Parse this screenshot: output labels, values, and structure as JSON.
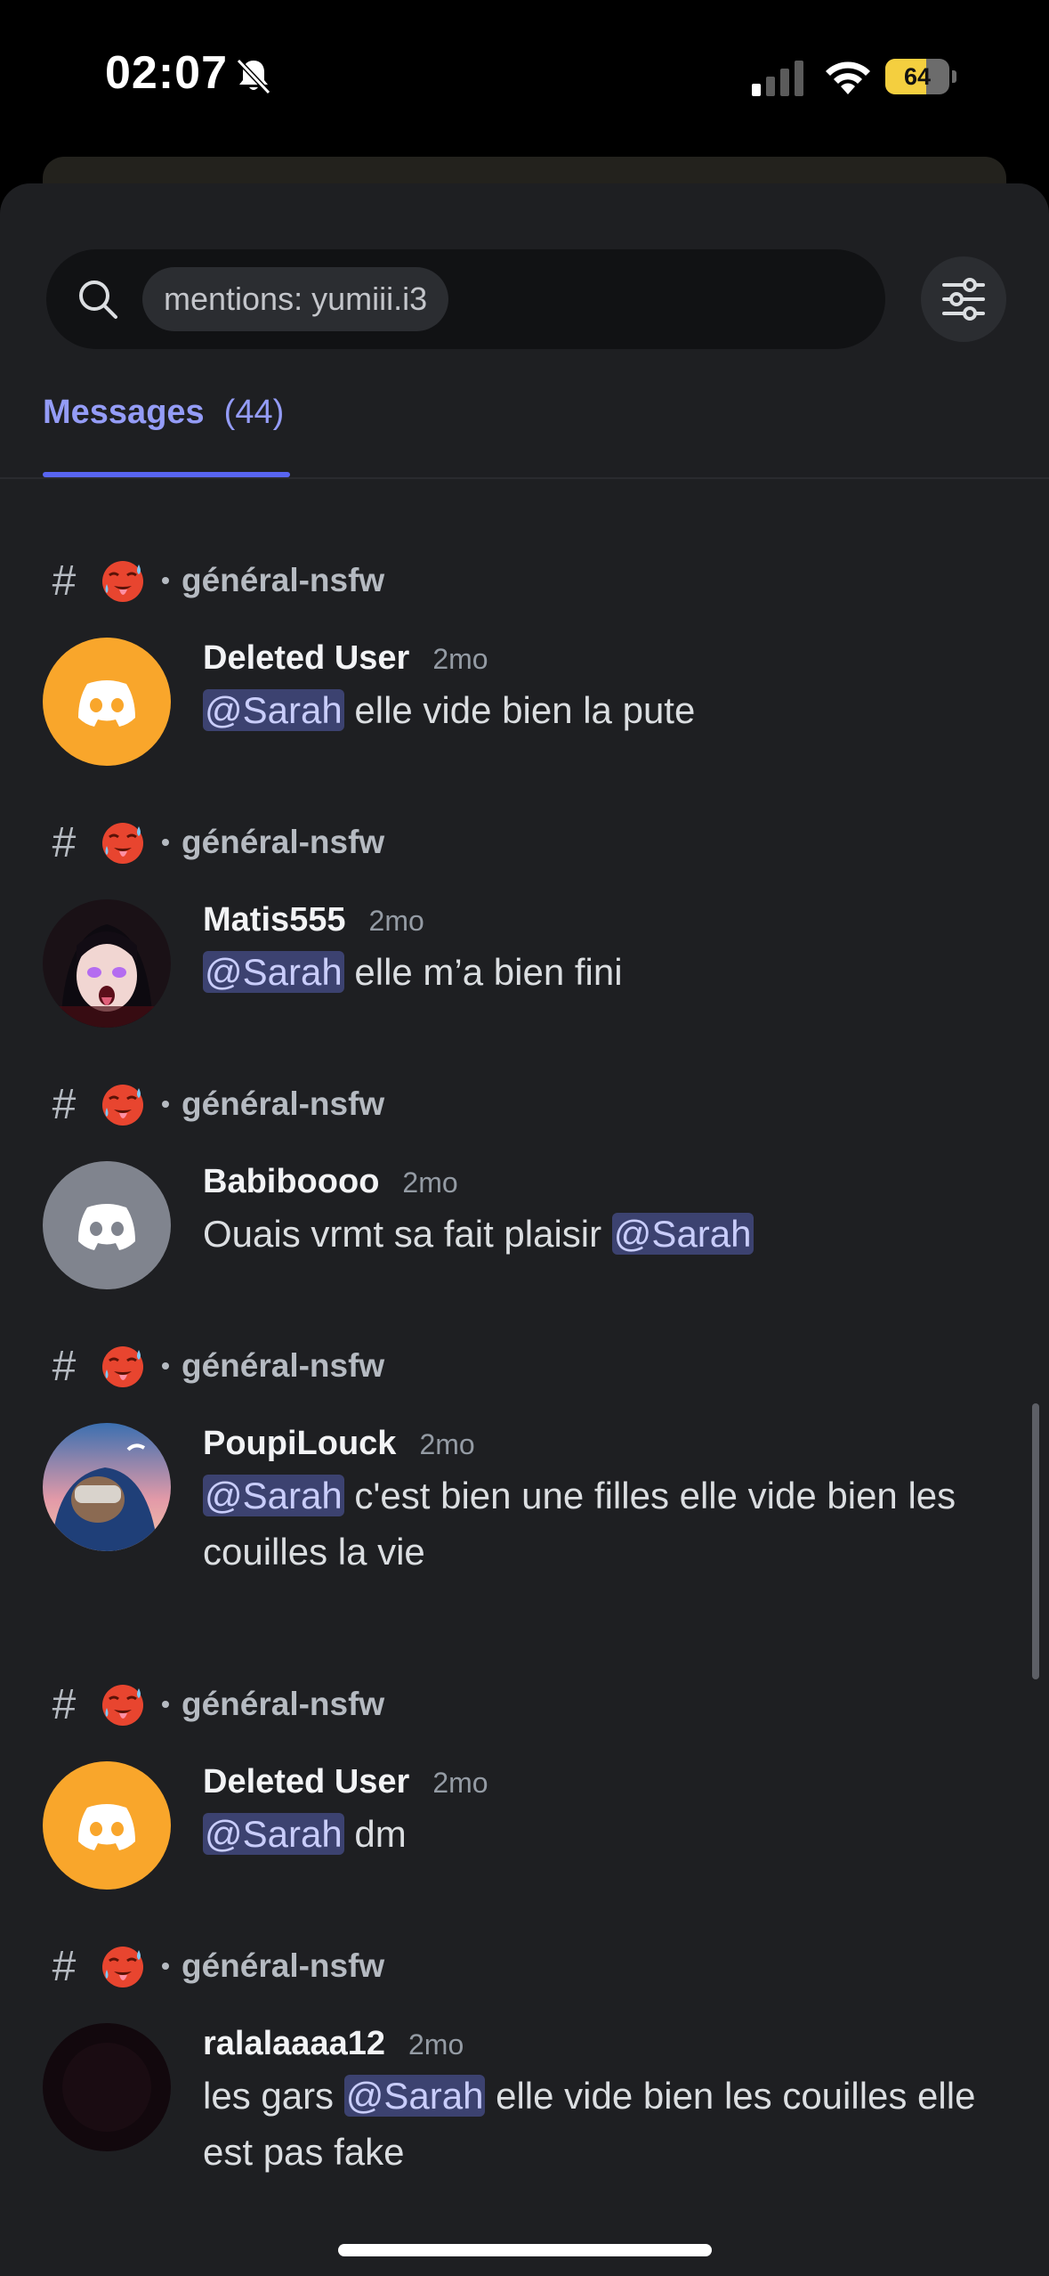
{
  "status_bar": {
    "time": "02:07",
    "battery_level": "64"
  },
  "search": {
    "query_chip": "mentions: yumiii.i3"
  },
  "tabs": [
    {
      "label": "Messages",
      "count": "(44)"
    }
  ],
  "results": [
    {
      "channel": "général-nsfw",
      "username": "Deleted User",
      "timestamp": "2mo",
      "message": {
        "before": "",
        "mention": "@Sarah",
        "after": " elle vide bien la pute"
      }
    },
    {
      "channel": "général-nsfw",
      "username": "Matis555",
      "timestamp": "2mo",
      "message": {
        "before": "",
        "mention": "@Sarah",
        "after": " elle m’a bien fini"
      }
    },
    {
      "channel": "général-nsfw",
      "username": "Babiboooo",
      "timestamp": "2mo",
      "message": {
        "before": "Ouais vrmt sa fait plaisir ",
        "mention": "@Sarah",
        "after": ""
      }
    },
    {
      "channel": "général-nsfw",
      "username": "PoupiLouck",
      "timestamp": "2mo",
      "message": {
        "before": "",
        "mention": "@Sarah",
        "after": " c'est bien une filles elle vide bien les couilles la vie"
      }
    },
    {
      "channel": "général-nsfw",
      "username": "Deleted User",
      "timestamp": "2mo",
      "message": {
        "before": "",
        "mention": "@Sarah",
        "after": " dm"
      }
    },
    {
      "channel": "général-nsfw",
      "username": "ralalaaaa12",
      "timestamp": "2mo",
      "message": {
        "before": "les gars ",
        "mention": "@Sarah",
        "after": " elle vide bien les couilles elle est pas fake"
      }
    }
  ],
  "colors": {
    "background": "#1e1f22",
    "accent": "#949cf7",
    "mention_bg": "#3c4270",
    "discord_orange": "#f9a62b",
    "discord_grey": "#80848e"
  },
  "icons": {
    "search": "search-icon",
    "filter": "filter-sliders-icon",
    "muted": "bell-slash-icon",
    "channel_emoji": "hot-face-emoji"
  }
}
